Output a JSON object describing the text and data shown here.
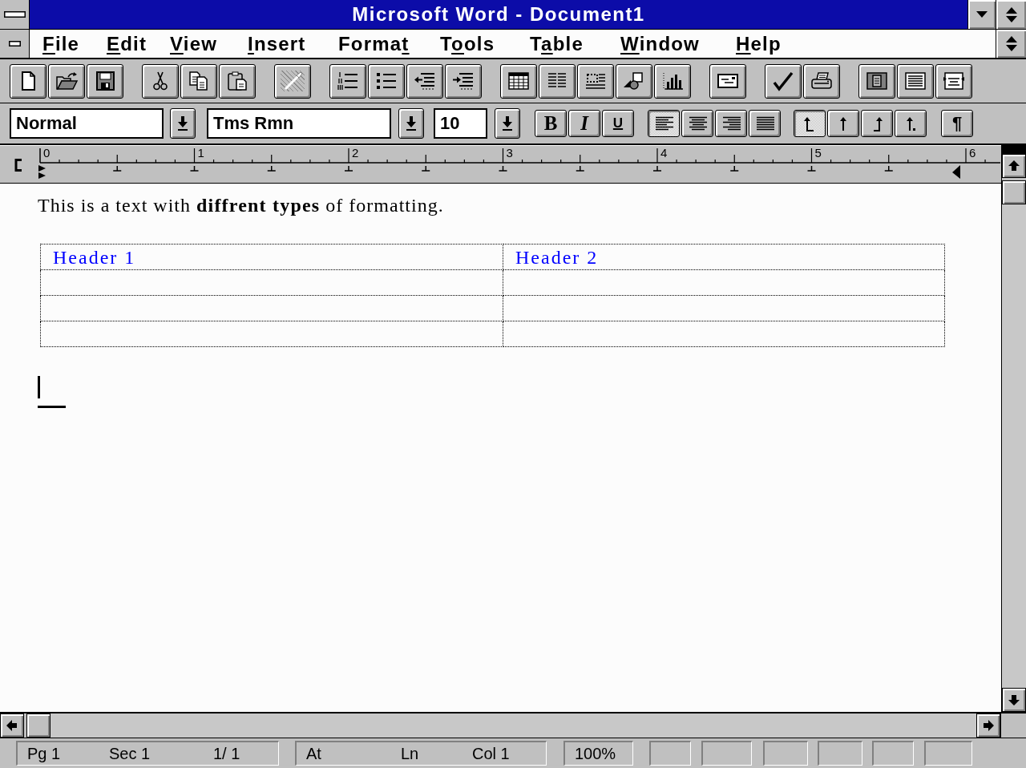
{
  "window": {
    "title": "Microsoft Word - Document1"
  },
  "menu": [
    {
      "key": "F",
      "after": "ile"
    },
    {
      "key": "E",
      "after": "dit"
    },
    {
      "key": "V",
      "after": "iew"
    },
    {
      "key": "I",
      "after": "nsert"
    },
    {
      "before": "Forma",
      "key": "t"
    },
    {
      "before": "T",
      "key": "o",
      "after": "ols"
    },
    {
      "before": "T",
      "key": "a",
      "after": "ble"
    },
    {
      "key": "W",
      "after": "indow"
    },
    {
      "key": "H",
      "after": "elp"
    }
  ],
  "toolbar": [
    [
      {
        "kind": "new",
        "disabled": false
      },
      {
        "kind": "open",
        "disabled": false
      },
      {
        "kind": "save",
        "disabled": false
      }
    ],
    [
      {
        "kind": "cut",
        "disabled": false
      },
      {
        "kind": "copy",
        "disabled": false
      },
      {
        "kind": "paste",
        "disabled": false
      }
    ],
    [
      {
        "kind": "undo",
        "disabled": true
      }
    ],
    [
      {
        "kind": "numbered",
        "disabled": false
      },
      {
        "kind": "bulleted",
        "disabled": false
      },
      {
        "kind": "unindent",
        "disabled": false
      },
      {
        "kind": "indent",
        "disabled": false
      }
    ],
    [
      {
        "kind": "table",
        "disabled": false
      },
      {
        "kind": "columns",
        "disabled": false
      },
      {
        "kind": "frame",
        "disabled": false
      },
      {
        "kind": "drawing",
        "disabled": false
      },
      {
        "kind": "chart",
        "disabled": false
      }
    ],
    [
      {
        "kind": "envelope",
        "disabled": false
      }
    ],
    [
      {
        "kind": "spelling",
        "disabled": false
      },
      {
        "kind": "print",
        "disabled": false
      }
    ],
    [
      {
        "kind": "whole_page",
        "disabled": false
      },
      {
        "kind": "zoom_100",
        "disabled": false
      },
      {
        "kind": "page_width",
        "disabled": false
      }
    ]
  ],
  "formatting": {
    "style": "Normal",
    "font": "Tms Rmn",
    "size": "10",
    "character": [
      {
        "kind": "bold",
        "label": "B",
        "selected": false
      },
      {
        "kind": "italic",
        "label": "I",
        "selected": false
      },
      {
        "kind": "underline",
        "label": "U",
        "selected": false
      }
    ],
    "alignment": [
      {
        "kind": "left",
        "selected": true
      },
      {
        "kind": "center",
        "selected": false
      },
      {
        "kind": "right",
        "selected": false
      },
      {
        "kind": "justify",
        "selected": false
      }
    ],
    "tab_stops": [
      {
        "kind": "left",
        "selected": true
      },
      {
        "kind": "center",
        "selected": false
      },
      {
        "kind": "right",
        "selected": false
      },
      {
        "kind": "decimal",
        "selected": false
      }
    ],
    "show_marks": {
      "label": "¶",
      "selected": false
    }
  },
  "ruler": {
    "numbers": [
      "0",
      "1",
      "2",
      "3",
      "4",
      "5",
      "6"
    ]
  },
  "document": {
    "paragraph": "This is a text with **diffrent types** of formatting.",
    "table": {
      "rows": [
        [
          "Header 1",
          "Header 2"
        ],
        [
          null,
          null
        ],
        [
          null,
          null
        ],
        [
          null,
          null
        ]
      ]
    }
  },
  "status_bar": {
    "panels": [
      [
        "Pg 1",
        "Sec 1",
        "1/ 1"
      ],
      [
        "At",
        "Ln",
        "Col 1"
      ],
      [
        "100%"
      ]
    ]
  }
}
